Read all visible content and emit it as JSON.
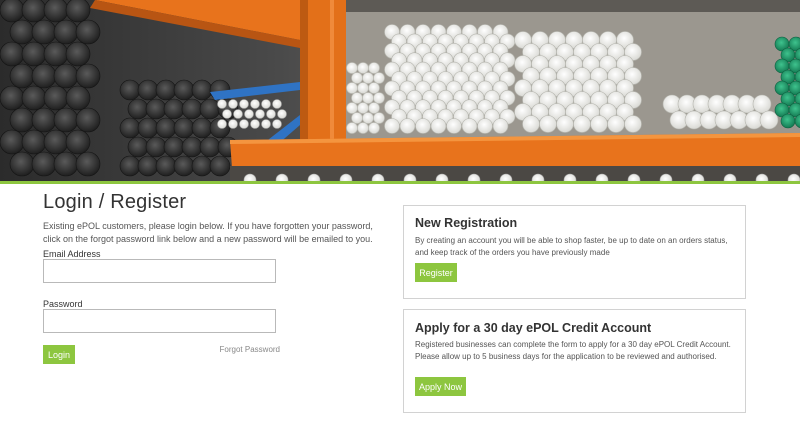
{
  "colors": {
    "accent_green": "#8dc63f",
    "shelf_orange": "#e8731c",
    "card_border": "#d2d2d2",
    "text_dark": "#333333"
  },
  "login": {
    "title": "Login / Register",
    "intro": "Existing ePOL customers, please login below. If you have forgotten your password, click on the forgot password link below and a new password will be emailed to you.",
    "email_label": "Email Address",
    "email_value": "",
    "password_label": "Password",
    "password_value": "",
    "login_button": "Login",
    "forgot_link": "Forgot Password"
  },
  "registration": {
    "title": "New Registration",
    "text": "By creating an account you will be able to shop faster, be up to date on an orders status, and keep track of the orders you have previously made",
    "button": "Register"
  },
  "credit": {
    "title": "Apply for a 30 day ePOL Credit Account",
    "text": "Registered businesses can complete the form to apply for a 30 day ePOL Credit Account. Please allow up to 5 business days for the application to be reviewed and authorised.",
    "button": "Apply Now"
  }
}
